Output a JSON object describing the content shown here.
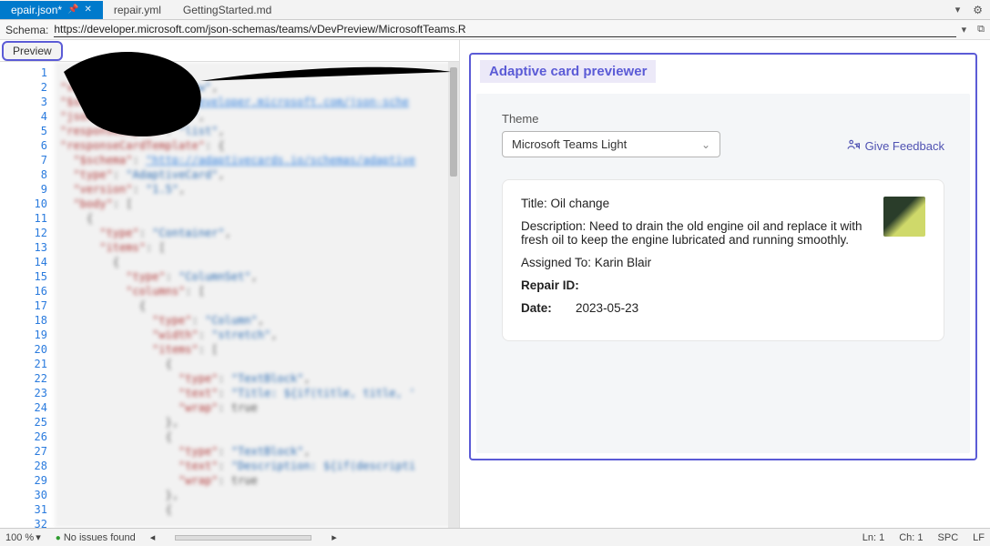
{
  "tabs": [
    {
      "label": "epair.json*",
      "active": true,
      "pinned": true,
      "closeable": true
    },
    {
      "label": "repair.yml",
      "active": false
    },
    {
      "label": "GettingStarted.md",
      "active": false
    }
  ],
  "schema": {
    "label": "Schema:",
    "url": "https://developer.microsoft.com/json-schemas/teams/vDevPreview/MicrosoftTeams.R"
  },
  "editor": {
    "preview_button": "Preview",
    "line_numbers": [
      1,
      2,
      3,
      4,
      5,
      6,
      7,
      8,
      9,
      10,
      11,
      12,
      13,
      14,
      15,
      16,
      17,
      18,
      19,
      20,
      21,
      22,
      23,
      24,
      25,
      26,
      27,
      28,
      29,
      30,
      31,
      32
    ]
  },
  "previewer": {
    "title": "Adaptive card previewer",
    "theme_label": "Theme",
    "theme_value": "Microsoft Teams Light",
    "feedback_label": "Give Feedback"
  },
  "card": {
    "title_label": "Title:",
    "title_value": "Oil change",
    "desc_label": "Description:",
    "desc_value": "Need to drain the old engine oil and replace it with fresh oil to keep the engine lubricated and running smoothly.",
    "assigned_label": "Assigned To:",
    "assigned_value": "Karin Blair",
    "repair_id_label": "Repair ID:",
    "repair_id_value": "",
    "date_label": "Date:",
    "date_value": "2023-05-23"
  },
  "status_bar": {
    "zoom": "100 %",
    "issues": "No issues found",
    "ln": "Ln: 1",
    "ch": "Ch: 1",
    "spc": "SPC",
    "lf": "LF"
  }
}
